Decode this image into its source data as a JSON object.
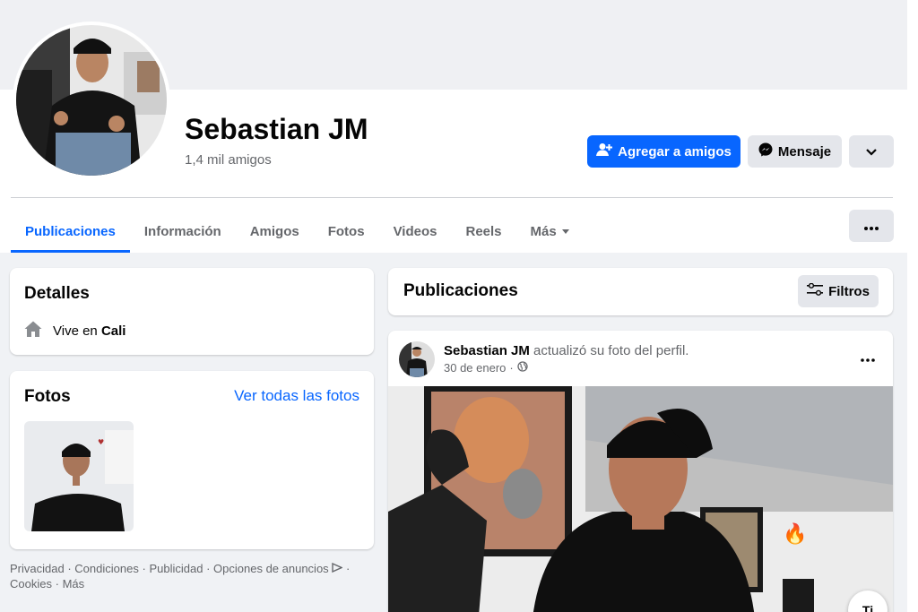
{
  "profile": {
    "name": "Sebastian JM",
    "friends": "1,4 mil amigos"
  },
  "actions": {
    "add_friend": "Agregar a amigos",
    "message": "Mensaje"
  },
  "tabs": [
    {
      "label": "Publicaciones",
      "active": true
    },
    {
      "label": "Información"
    },
    {
      "label": "Amigos"
    },
    {
      "label": "Fotos"
    },
    {
      "label": "Videos"
    },
    {
      "label": "Reels"
    },
    {
      "label": "Más"
    }
  ],
  "details": {
    "title": "Detalles",
    "lives_prefix": "Vive en",
    "city": "Cali"
  },
  "photos": {
    "title": "Fotos",
    "see_all": "Ver todas las fotos"
  },
  "footer": {
    "privacy": "Privacidad",
    "terms": "Condiciones",
    "advertising": "Publicidad",
    "ad_choices": "Opciones de anuncios",
    "cookies": "Cookies",
    "more": "Más",
    "separator": "·"
  },
  "publications": {
    "title": "Publicaciones",
    "filters": "Filtros"
  },
  "post": {
    "author": "Sebastian JM",
    "action": "actualizó su foto del perfil.",
    "date": "30 de enero",
    "separator": "·",
    "photo_action": "Ti"
  },
  "colors": {
    "accent": "#0866ff",
    "background": "#f0f2f5",
    "secondary_text": "#65676b",
    "button_gray": "#e4e6eb"
  },
  "icons": {
    "add_friend": "person-plus-icon",
    "message": "messenger-icon",
    "chevron": "chevron-down-icon",
    "more": "more-dots-icon",
    "home": "home-icon",
    "filters": "sliders-icon",
    "globe": "globe-icon",
    "ad_choices": "ad-choices-icon"
  }
}
